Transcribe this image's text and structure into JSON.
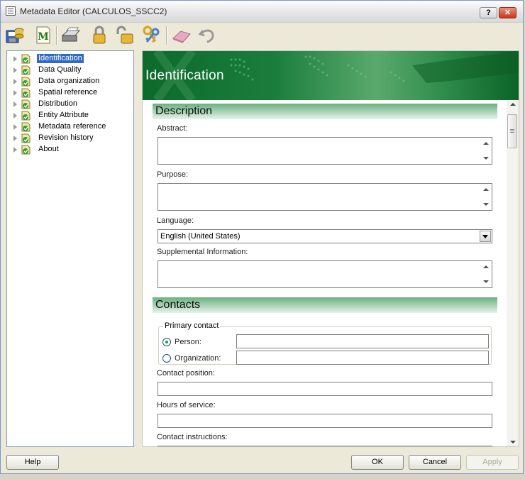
{
  "window": {
    "title": "Metadata Editor (CALCULOS_SSCC2)",
    "help_button": "?",
    "close_button": "✕"
  },
  "toolbar": {
    "icons": [
      "save-to-database-icon",
      "metadata-m-icon",
      "print-icon",
      "lock-icon",
      "unlock-icon",
      "keys-icon",
      "eraser-icon",
      "undo-icon"
    ]
  },
  "tree": {
    "items": [
      {
        "label": "Identification",
        "selected": true
      },
      {
        "label": "Data Quality"
      },
      {
        "label": "Data organization"
      },
      {
        "label": "Spatial reference"
      },
      {
        "label": "Distribution"
      },
      {
        "label": "Entity Attribute"
      },
      {
        "label": "Metadata reference"
      },
      {
        "label": "Revision history"
      },
      {
        "label": "About"
      }
    ]
  },
  "content": {
    "banner_title": "Identification",
    "description": {
      "header": "Description",
      "abstract_label": "Abstract:",
      "abstract_value": "",
      "purpose_label": "Purpose:",
      "purpose_value": "",
      "language_label": "Language:",
      "language_value": "English (United States)",
      "supplemental_label": "Supplemental Information:",
      "supplemental_value": ""
    },
    "contacts": {
      "header": "Contacts",
      "primary_contact_legend": "Primary contact",
      "person_label": "Person:",
      "person_selected": true,
      "person_value": "",
      "organization_label": "Organization:",
      "organization_value": "",
      "position_label": "Contact position:",
      "position_value": "",
      "hours_label": "Hours of service:",
      "hours_value": "",
      "instructions_label": "Contact instructions:"
    }
  },
  "footer": {
    "help_label": "Help",
    "ok_label": "OK",
    "cancel_label": "Cancel",
    "apply_label": "Apply"
  },
  "colors": {
    "selection": "#316ac5",
    "banner_green": "#0c6a2b",
    "section_green": "#6ab07c"
  }
}
